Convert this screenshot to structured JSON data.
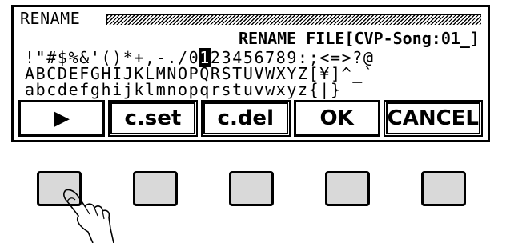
{
  "screen": {
    "title": "RENAME",
    "file_line": "RENAME FILE[CVP-Song:01_]",
    "charset": {
      "row1_before": "!\"#$%&'()*+,-./0",
      "row1_cursor": "1",
      "row1_after": "23456789:;<=>?@",
      "row2": "ABCDEFGHIJKLMNOPQRSTUVWXYZ[¥]^_`",
      "row3": "abcdefghijklmnopqrstuvwxyz{|}"
    }
  },
  "softkeys": [
    "▶",
    "c.set",
    "c.del",
    "OK",
    "CANCEL"
  ],
  "colors": {
    "lcd_bg": "#ffffff",
    "button_fill": "#d9d9d9"
  },
  "pressed_button": 1
}
